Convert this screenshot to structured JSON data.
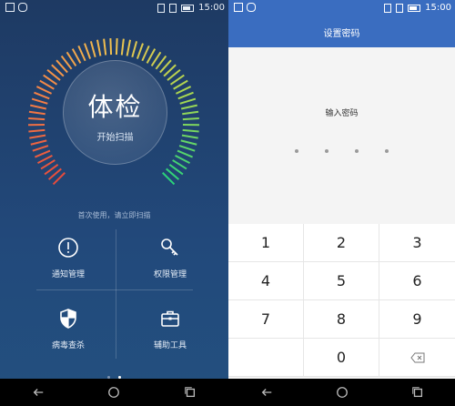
{
  "left": {
    "status": {
      "time": "15:00"
    },
    "gauge": {
      "title": "体检",
      "subtitle": "开始扫描"
    },
    "hint": "首次使用，请立即扫描",
    "grid": [
      {
        "label": "通知管理",
        "icon": "exclamation-circle-icon"
      },
      {
        "label": "权限管理",
        "icon": "key-icon"
      },
      {
        "label": "病毒查杀",
        "icon": "shield-icon"
      },
      {
        "label": "辅助工具",
        "icon": "toolbox-icon"
      }
    ],
    "page_dots": {
      "count": 2,
      "active": 1
    }
  },
  "right": {
    "status": {
      "time": "15:00"
    },
    "title": "设置密码",
    "prompt": "输入密码",
    "keys": [
      "1",
      "2",
      "3",
      "4",
      "5",
      "6",
      "7",
      "8",
      "9",
      "",
      "0",
      "⌫"
    ]
  },
  "nav": {
    "back": "back-icon",
    "home": "home-icon",
    "recent": "recent-apps-icon"
  },
  "colors": {
    "left_bg": "#22497b",
    "right_header": "#3a6dc0",
    "gauge_red": "#e64b3c",
    "gauge_green": "#2bd37a"
  }
}
